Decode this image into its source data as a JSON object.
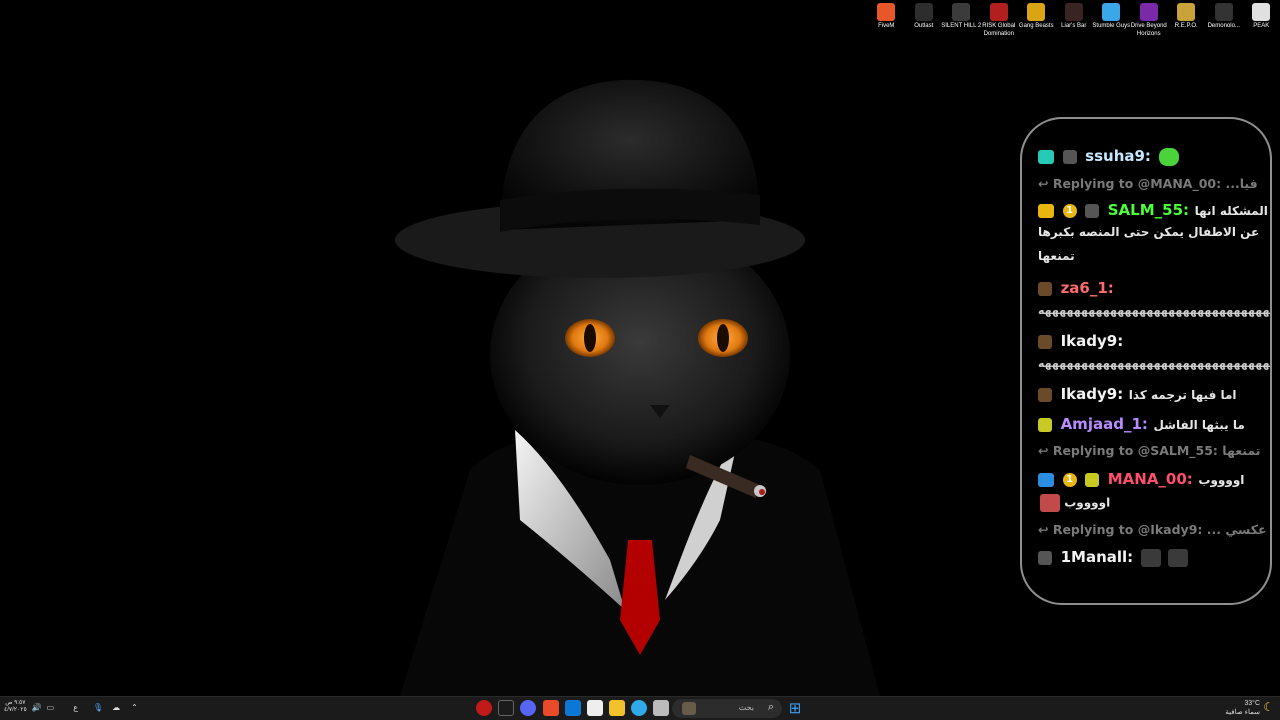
{
  "desktop_icons": [
    {
      "label": "FiveM",
      "color": "#e8572a"
    },
    {
      "label": "Outlast",
      "color": "#2d2d2d"
    },
    {
      "label": "SILENT HILL 2",
      "color": "#3b3b3b"
    },
    {
      "label": "RISK Global Domination",
      "color": "#b21f1f"
    },
    {
      "label": "Gang Beasts",
      "color": "#d9a514"
    },
    {
      "label": "Liar's Bar",
      "color": "#3a2323"
    },
    {
      "label": "Stumble Guys",
      "color": "#3aa7e8"
    },
    {
      "label": "Drive Beyond Horizons",
      "color": "#7a2aa8"
    },
    {
      "label": "R.E.P.O.",
      "color": "#c9a23a"
    },
    {
      "label": "Demonolo...",
      "color": "#333"
    },
    {
      "label": "PEAK",
      "color": "#e0e0e0"
    }
  ],
  "chat": {
    "messages": [
      {
        "user": "ssuha9:",
        "color": "#c6e8ff",
        "text": ""
      },
      {
        "reply": "Replying to @MANA_00: ...فيا"
      },
      {
        "user": "SALM_55:",
        "color": "#4cff3a",
        "text": "المشكله انها",
        "line2": "عن الاطفال يمكن حتى المنصه بكبرها",
        "line3": "تمنعها"
      },
      {
        "user": "za6_1:",
        "color": "#ff6b6b",
        "spam": "ههههههههههههههههههههههههههههههههههه"
      },
      {
        "user": "Ikady9:",
        "color": "#f3f3f3",
        "spam": "ههههههههههههههههههههههههههههههههههه"
      },
      {
        "user": "Ikady9:",
        "color": "#f3f3f3",
        "text": "اما فيها ترجمه كذا"
      },
      {
        "user": "Amjaad_1:",
        "color": "#b88cff",
        "text": "ما يبثها الفاشل"
      },
      {
        "reply": "Replying to @SALM_55: تمنعها"
      },
      {
        "user": "MANA_00:",
        "color": "#ff4f6d",
        "text": "اووووب",
        "line2": "اووووب"
      },
      {
        "reply": "Replying to @Ikady9: ... عكسي"
      },
      {
        "user": "1Manall:",
        "color": "#f3f3f3",
        "text": ""
      }
    ]
  },
  "taskbar": {
    "search_placeholder": "بحث",
    "language": "ع",
    "time": "٩:٥٧ ص",
    "date": "٤/٧/٢٠٢٥",
    "weather_temp": "33°C",
    "weather_desc": "سماء صافية"
  }
}
